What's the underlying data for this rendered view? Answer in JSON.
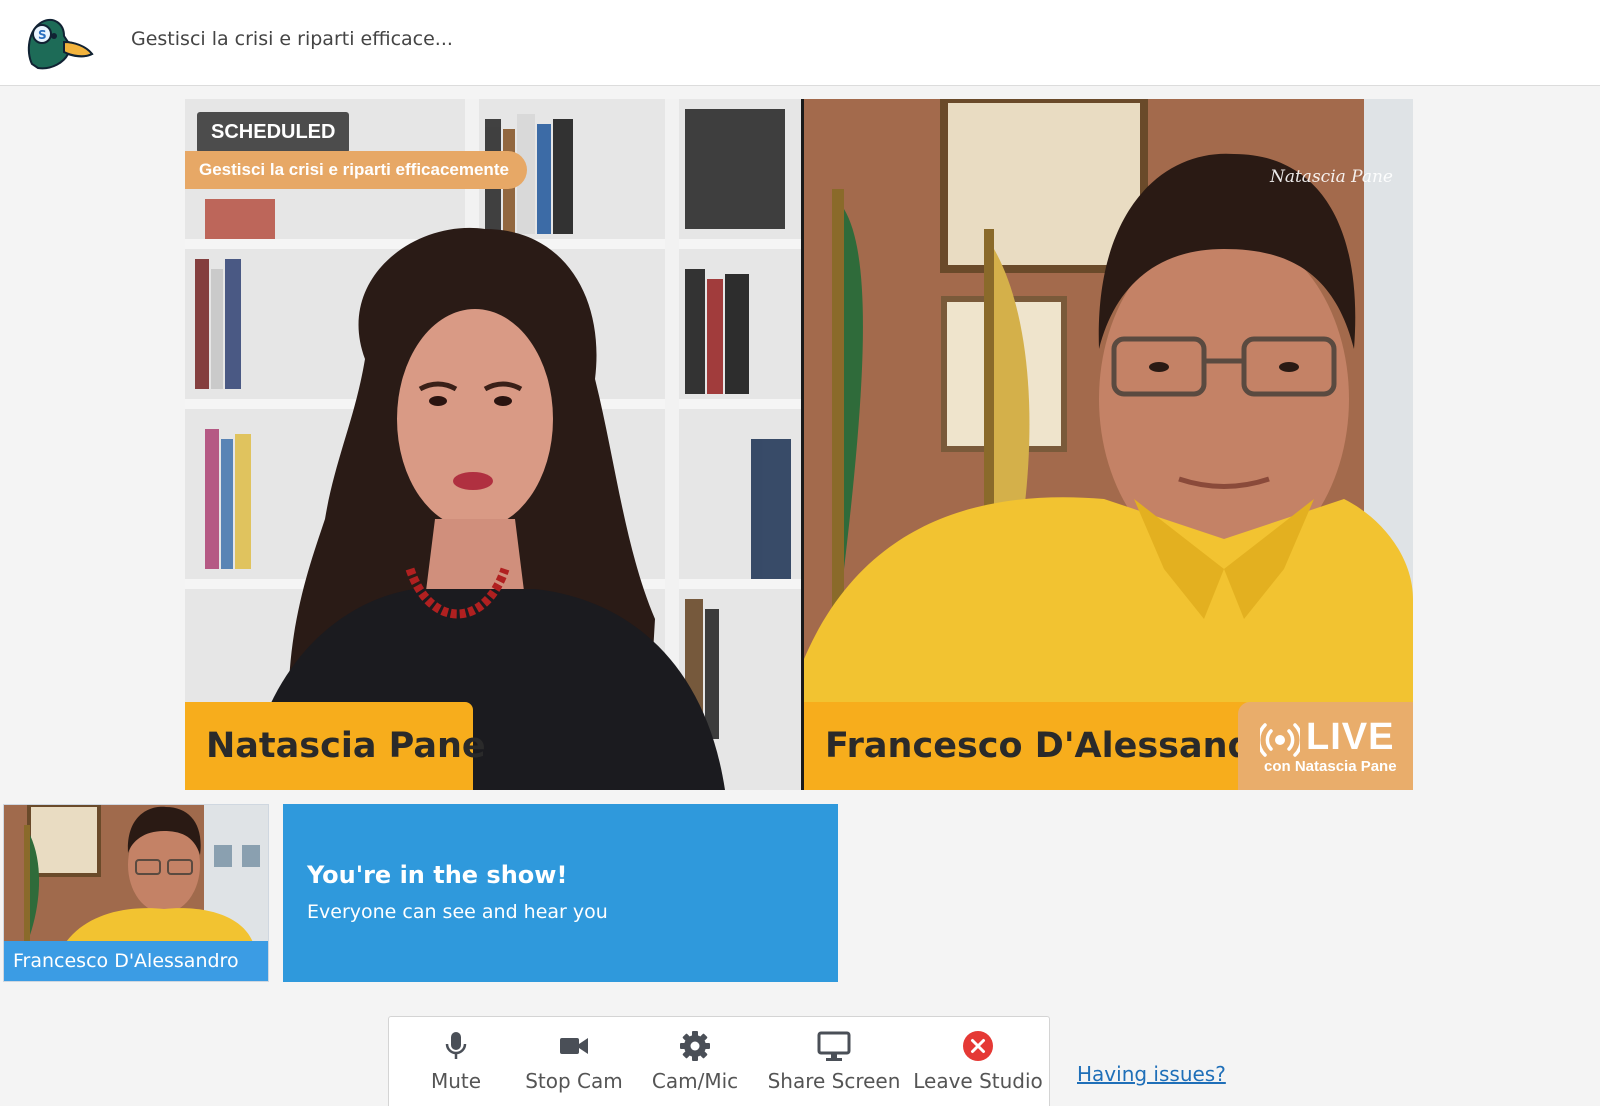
{
  "header": {
    "show_title": "Gestisci la crisi e riparti efficace..."
  },
  "stage": {
    "status_badge": "SCHEDULED",
    "banner_text": "Gestisci la crisi e riparti efficacemente",
    "participants": [
      {
        "name": "Natascia Pane"
      },
      {
        "name": "Francesco D'Alessandro"
      }
    ],
    "live_badge": {
      "word": "LIVE",
      "subtitle": "con Natascia Pane"
    },
    "watermark": "Natascia Pane"
  },
  "self_preview": {
    "name": "Francesco D'Alessandro"
  },
  "in_show": {
    "title": "You're in the show!",
    "subtitle": "Everyone can see and hear you"
  },
  "toolbar": {
    "mute_label": "Mute",
    "stop_cam_label": "Stop Cam",
    "cam_mic_label": "Cam/Mic",
    "share_screen_label": "Share Screen",
    "leave_studio_label": "Leave Studio"
  },
  "help_link": "Having issues?",
  "colors": {
    "nameplate": "#f7ad1c",
    "banner": "#e7a866",
    "in_show_panel": "#2f99dc",
    "self_name_bar": "#3b9ce4",
    "leave_icon": "#e53935",
    "link": "#1f6fb8"
  }
}
